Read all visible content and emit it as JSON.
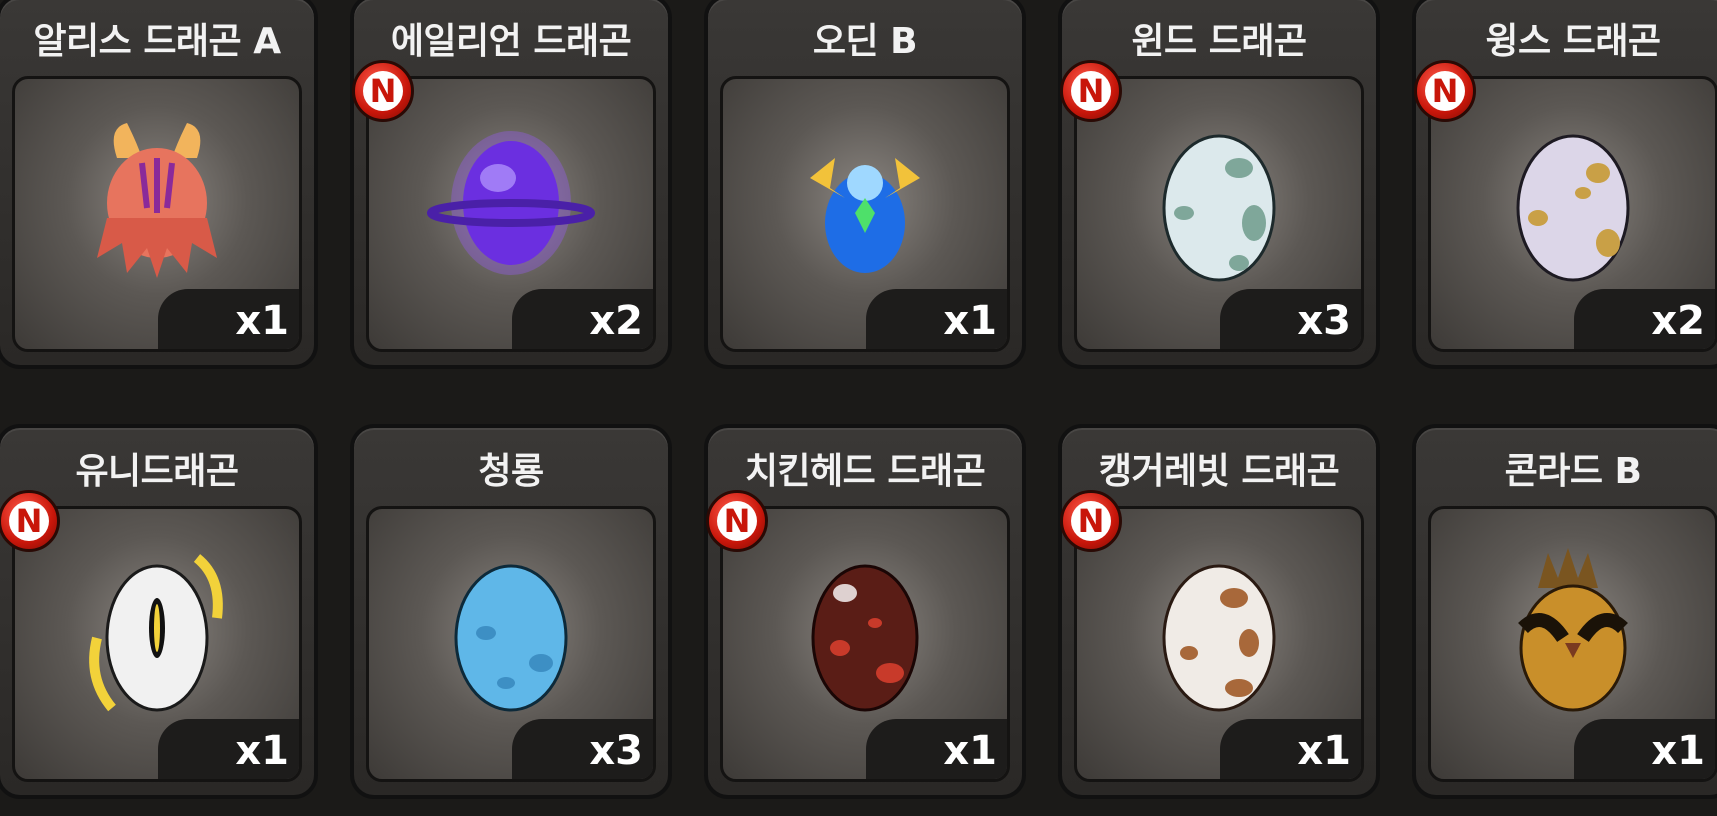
{
  "items": [
    {
      "name": "알리스 드래곤 A",
      "count": "x1",
      "is_new": false,
      "egg_color": "#e7745e",
      "icon": "alice-dragon-egg-icon"
    },
    {
      "name": "에일리언 드래곤",
      "count": "x2",
      "is_new": true,
      "egg_color": "#6b2fe0",
      "icon": "alien-dragon-egg-icon"
    },
    {
      "name": "오딘 B",
      "count": "x1",
      "is_new": false,
      "egg_color": "#1e6de6",
      "icon": "odin-egg-icon"
    },
    {
      "name": "윈드 드래곤",
      "count": "x3",
      "is_new": true,
      "egg_color": "#dce9ec",
      "icon": "wind-dragon-egg-icon"
    },
    {
      "name": "윙스 드래곤",
      "count": "x2",
      "is_new": true,
      "egg_color": "#dcd6e8",
      "icon": "wings-dragon-egg-icon"
    },
    {
      "name": "유니드래곤",
      "count": "x1",
      "is_new": true,
      "egg_color": "#f1f1f1",
      "icon": "uni-dragon-egg-icon"
    },
    {
      "name": "청룡",
      "count": "x3",
      "is_new": false,
      "egg_color": "#5fb7e8",
      "icon": "blue-dragon-egg-icon"
    },
    {
      "name": "치킨헤드 드래곤",
      "count": "x1",
      "is_new": true,
      "egg_color": "#5a1d16",
      "icon": "chickenhead-dragon-egg-icon"
    },
    {
      "name": "캥거레빗 드래곤",
      "count": "x1",
      "is_new": true,
      "egg_color": "#f0ebe6",
      "icon": "kangarabbit-dragon-egg-icon"
    },
    {
      "name": "콘라드 B",
      "count": "x1",
      "is_new": false,
      "egg_color": "#c98f2a",
      "icon": "conrad-egg-icon"
    }
  ],
  "new_badge_label": "N"
}
